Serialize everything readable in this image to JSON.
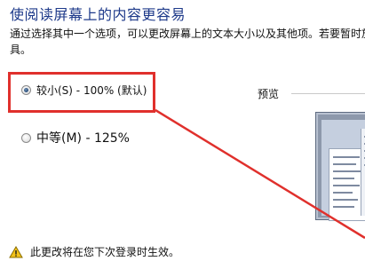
{
  "header": {
    "title": "使阅读屏幕上的内容更容易"
  },
  "description": {
    "line1": "通过选择其中一个选项，可以更改屏幕上的文本大小以及其他项。若要暂时放",
    "line2": "具。"
  },
  "options": [
    {
      "label": "较小(S) - 100% (默认)",
      "selected": true
    },
    {
      "label": "中等(M) - 125%",
      "selected": false
    }
  ],
  "preview": {
    "label": "预览"
  },
  "footer": {
    "notice": "此更改将在您下次登录时生效。",
    "icon": "warning-icon"
  },
  "colors": {
    "title": "#1e3a8a",
    "highlight": "#e0302c"
  }
}
